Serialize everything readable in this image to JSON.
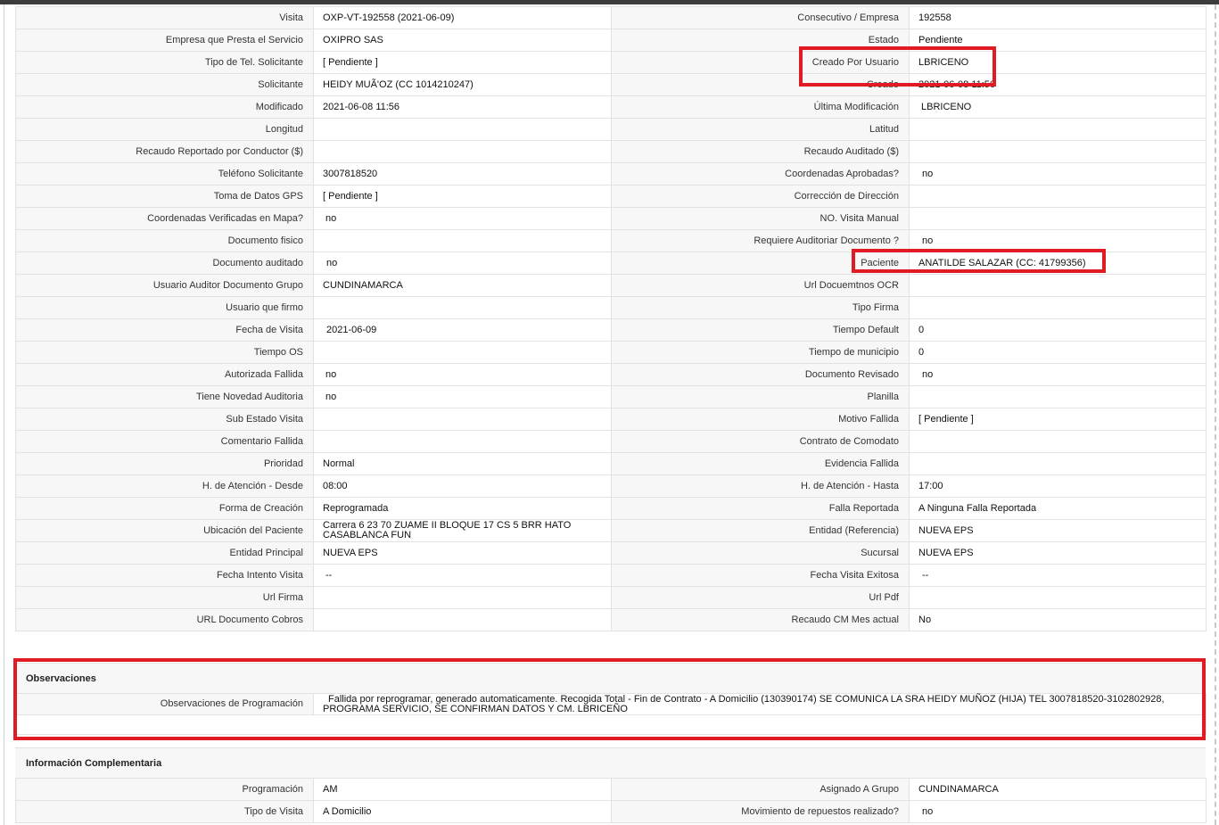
{
  "main": {
    "rows": [
      {
        "l1": "Visita",
        "v1": "OXP-VT-192558 (2021-06-09)",
        "l2": "Consecutivo / Empresa",
        "v2": "192558"
      },
      {
        "l1": "Empresa que Presta el Servicio",
        "v1": "OXIPRO SAS",
        "l2": "Estado",
        "v2": "Pendiente"
      },
      {
        "l1": "Tipo de Tel. Solicitante",
        "v1": "[ Pendiente ]",
        "l2": "Creado Por Usuario",
        "v2": "LBRICENO"
      },
      {
        "l1": "Solicitante",
        "v1": "HEIDY MUÃ'OZ (CC 1014210247)",
        "l2": "Creado",
        "v2": "2021-06-08 11:56"
      },
      {
        "l1": "Modificado",
        "v1": "2021-06-08 11:56",
        "l2": "Última Modificación",
        "v2": "LBRICENO"
      },
      {
        "l1": "Longitud",
        "v1": "",
        "l2": "Latitud",
        "v2": ""
      },
      {
        "l1": "Recaudo Reportado por Conductor ($)",
        "v1": "",
        "l2": "Recaudo Auditado ($)",
        "v2": ""
      },
      {
        "l1": "Teléfono Solicitante",
        "v1": "3007818520",
        "l2": "Coordenadas Aprobadas?",
        "v2": "no"
      },
      {
        "l1": "Toma de Datos GPS",
        "v1": "[ Pendiente ]",
        "l2": "Corrección de Dirección",
        "v2": ""
      },
      {
        "l1": "Coordenadas Verificadas en Mapa?",
        "v1": "no",
        "l2": "NO. Visita Manual",
        "v2": ""
      },
      {
        "l1": "Documento fisico",
        "v1": "",
        "l2": "Requiere Auditoriar Documento ?",
        "v2": "no"
      },
      {
        "l1": "Documento auditado",
        "v1": "no",
        "l2": "Paciente",
        "v2": "ANATILDE SALAZAR (CC: 41799356)"
      },
      {
        "l1": "Usuario Auditor Documento Grupo",
        "v1": "CUNDINAMARCA",
        "l2": "Url Docuemtnos OCR",
        "v2": ""
      },
      {
        "l1": "Usuario que firmo",
        "v1": "",
        "l2": "Tipo Firma",
        "v2": ""
      },
      {
        "l1": "Fecha de Visita",
        "v1": "2021-06-09",
        "l2": "Tiempo Default",
        "v2": "0"
      },
      {
        "l1": "Tiempo OS",
        "v1": "",
        "l2": "Tiempo de municipio",
        "v2": "0"
      },
      {
        "l1": "Autorizada Fallida",
        "v1": "no",
        "l2": "Documento Revisado",
        "v2": "no"
      },
      {
        "l1": "Tiene Novedad Auditoria",
        "v1": "no",
        "l2": "Planilla",
        "v2": ""
      },
      {
        "l1": "Sub Estado Visita",
        "v1": "",
        "l2": "Motivo Fallida",
        "v2": "[ Pendiente ]"
      },
      {
        "l1": "Comentario Fallida",
        "v1": "",
        "l2": "Contrato de Comodato",
        "v2": ""
      },
      {
        "l1": "Prioridad",
        "v1": "Normal",
        "l2": "Evidencia Fallida",
        "v2": ""
      },
      {
        "l1": "H. de Atención - Desde",
        "v1": "08:00",
        "l2": "H. de Atención - Hasta",
        "v2": "17:00"
      },
      {
        "l1": "Forma de Creación",
        "v1": "Reprogramada",
        "l2": "Falla Reportada",
        "v2": "A Ninguna Falla Reportada"
      },
      {
        "l1": "Ubicación del Paciente",
        "v1": "Carrera 6 23 70 ZUAME II BLOQUE 17 CS 5 BRR HATO CASABLANCA FUN",
        "l2": "Entidad (Referencia)",
        "v2": "NUEVA EPS"
      },
      {
        "l1": "Entidad Principal",
        "v1": "NUEVA EPS",
        "l2": "Sucursal",
        "v2": "NUEVA EPS"
      },
      {
        "l1": "Fecha Intento Visita",
        "v1": "--",
        "l2": "Fecha Visita Exitosa",
        "v2": "--"
      },
      {
        "l1": "Url Firma",
        "v1": "",
        "l2": "Url Pdf",
        "v2": ""
      },
      {
        "l1": "URL Documento Cobros",
        "v1": "",
        "l2": "Recaudo CM Mes actual",
        "v2": "No"
      }
    ]
  },
  "observaciones": {
    "title": "Observaciones",
    "label": "Observaciones de Programación",
    "text": "Fallida por reprogramar, generado automaticamente. Recogida Total - Fin de Contrato - A Domicilio (130390174) SE COMUNICA LA SRA HEIDY MUÑOZ (HIJA) TEL 3007818520-3102802928, PROGRAMA SERVICIO, SE CONFIRMAN DATOS Y CM. LBRICEÑO"
  },
  "info": {
    "title": "Información Complementaria",
    "rows": [
      {
        "l1": "Programación",
        "v1": "AM",
        "l2": "Asignado A Grupo",
        "v2": "CUNDINAMARCA"
      },
      {
        "l1": "Tipo de Visita",
        "v1": "A Domicilio",
        "l2": "Movimiento de repuestos realizado?",
        "v2": "no"
      }
    ]
  },
  "colors": {
    "highlight": "#e01b24",
    "label_bg": "#f7f7f7",
    "border": "#e2e2e2"
  }
}
